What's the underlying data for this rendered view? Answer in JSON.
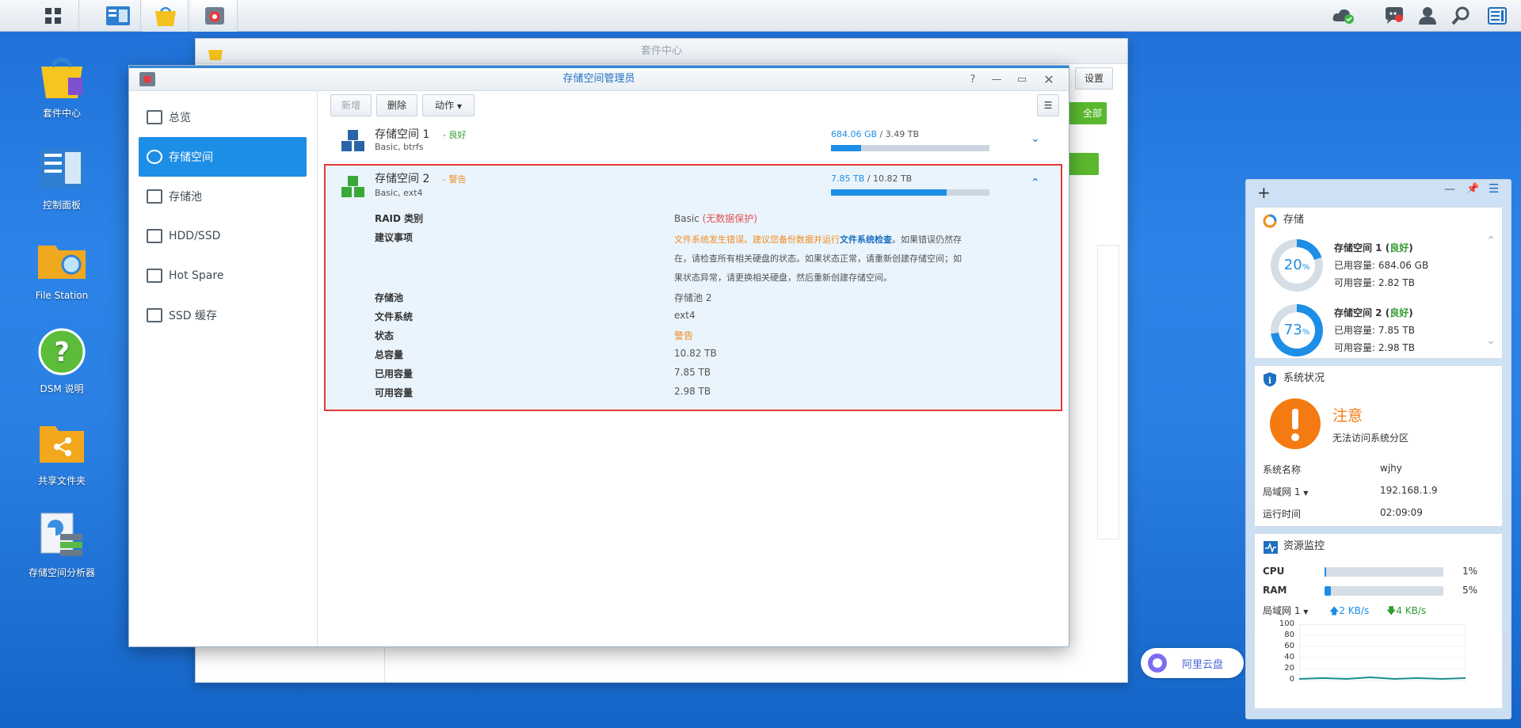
{
  "desktop": {
    "icons": [
      {
        "label": "套件中心"
      },
      {
        "label": "控制面板"
      },
      {
        "label": "File Station"
      },
      {
        "label": "DSM 说明"
      },
      {
        "label": "共享文件夹"
      },
      {
        "label": "存储空间分析器"
      }
    ]
  },
  "back_window": {
    "title": "套件中心",
    "settings_label": "设置",
    "green_label": "全部"
  },
  "main_window": {
    "title": "存储空间管理员",
    "sidebar": [
      {
        "label": "总览"
      },
      {
        "label": "存储空间"
      },
      {
        "label": "存储池"
      },
      {
        "label": "HDD/SSD"
      },
      {
        "label": "Hot Spare"
      },
      {
        "label": "SSD 缓存"
      }
    ],
    "toolbar": {
      "new": "新增",
      "delete": "删除",
      "action": "动作"
    },
    "volumes": [
      {
        "name": "存储空间 1",
        "status": "良好",
        "sub": "Basic, btrfs",
        "used": "684.06 GB",
        "total": "3.49 TB",
        "usage_fraction": 0.19
      },
      {
        "name": "存储空间 2",
        "status": "警告",
        "sub": "Basic, ext4",
        "used": "7.85 TB",
        "total": "10.82 TB",
        "usage_fraction": 0.73
      }
    ],
    "details": {
      "raid_label": "RAID 类别",
      "raid_value": "Basic",
      "raid_note": "(无数据保护)",
      "advice_label": "建议事项",
      "advice_warn": "文件系统发生错误。建议您备份数据并运行",
      "advice_link": "文件系统检查",
      "advice_line1_rest": "。如果错误仍然存",
      "advice_line2": "在，请检查所有相关硬盘的状态。如果状态正常，请重新创建存储空间；如",
      "advice_line3": "果状态异常，请更换相关硬盘，然后重新创建存储空间。",
      "pool_label": "存储池",
      "pool_value": "存储池 2",
      "fs_label": "文件系统",
      "fs_value": "ext4",
      "state_label": "状态",
      "state_value": "警告",
      "total_label": "总容量",
      "total_value": "10.82 TB",
      "used_label": "已用容量",
      "used_value": "7.85 TB",
      "free_label": "可用容量",
      "free_value": "2.98 TB"
    }
  },
  "widgets": {
    "storage": {
      "title": "存储",
      "items": [
        {
          "percent": "20",
          "unit": "%",
          "name": "存储空间 1",
          "status": "良好",
          "used_label": "已用容量:",
          "used": "684.06 GB",
          "free_label": "可用容量:",
          "free": "2.82 TB",
          "fraction": 0.2
        },
        {
          "percent": "73",
          "unit": "%",
          "name": "存储空间 2",
          "status": "良好",
          "used_label": "已用容量:",
          "used": "7.85 TB",
          "free_label": "可用容量:",
          "free": "2.98 TB",
          "fraction": 0.73
        }
      ]
    },
    "system": {
      "title": "系统状况",
      "state": "注意",
      "message": "无法访问系统分区",
      "rows": [
        {
          "label": "系统名称",
          "value": "wjhy"
        },
        {
          "label": "局域网 1",
          "value": "192.168.1.9"
        },
        {
          "label": "运行时间",
          "value": "02:09:09"
        }
      ]
    },
    "monitor": {
      "title": "资源监控",
      "cpu_label": "CPU",
      "cpu_value": "1%",
      "cpu_fraction": 0.01,
      "ram_label": "RAM",
      "ram_value": "5%",
      "ram_fraction": 0.05,
      "lan_label": "局域网 1",
      "up": "2 KB/s",
      "down": "4 KB/s",
      "yticks": [
        "100",
        "80",
        "60",
        "40",
        "20",
        "0"
      ]
    }
  },
  "cloud_pill": {
    "label": "阿里云盘"
  },
  "colors": {
    "accent": "#1d8ee6",
    "good": "#2e9b2e",
    "warn": "#f08c1e",
    "error": "#e05050",
    "highlight_border": "#e53935"
  }
}
